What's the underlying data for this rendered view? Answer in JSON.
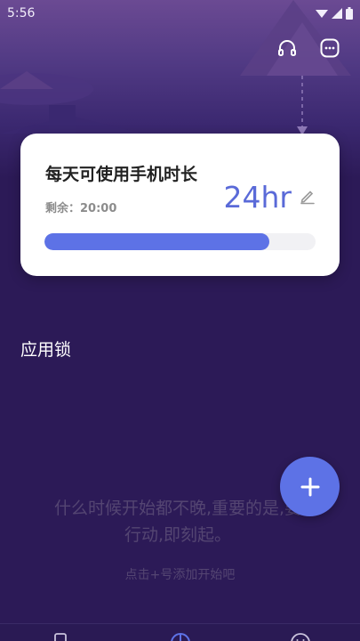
{
  "status_bar": {
    "time": "5:56"
  },
  "header": {
    "support_icon": "headset-icon",
    "more_icon": "more-dots-icon"
  },
  "card": {
    "title": "每天可使用手机时长",
    "remaining": "剩余：20:00",
    "hours": "24hr",
    "progress_percent": 83,
    "edit_icon": "pencil-icon"
  },
  "section": {
    "label": "应用锁"
  },
  "empty_state": {
    "message": "什么时候开始都不晚,重要的是,要行动,即刻起。",
    "hint": "点击+号添加开始吧"
  },
  "fab": {
    "icon": "plus-icon"
  },
  "bottom_nav": {
    "items": [
      {
        "icon": "phone-icon"
      },
      {
        "icon": "pie-chart-icon"
      },
      {
        "icon": "smiley-icon"
      }
    ]
  },
  "colors": {
    "accent": "#5d72e6",
    "hours_text": "#5a6ad8",
    "background": "#2c1a57"
  }
}
